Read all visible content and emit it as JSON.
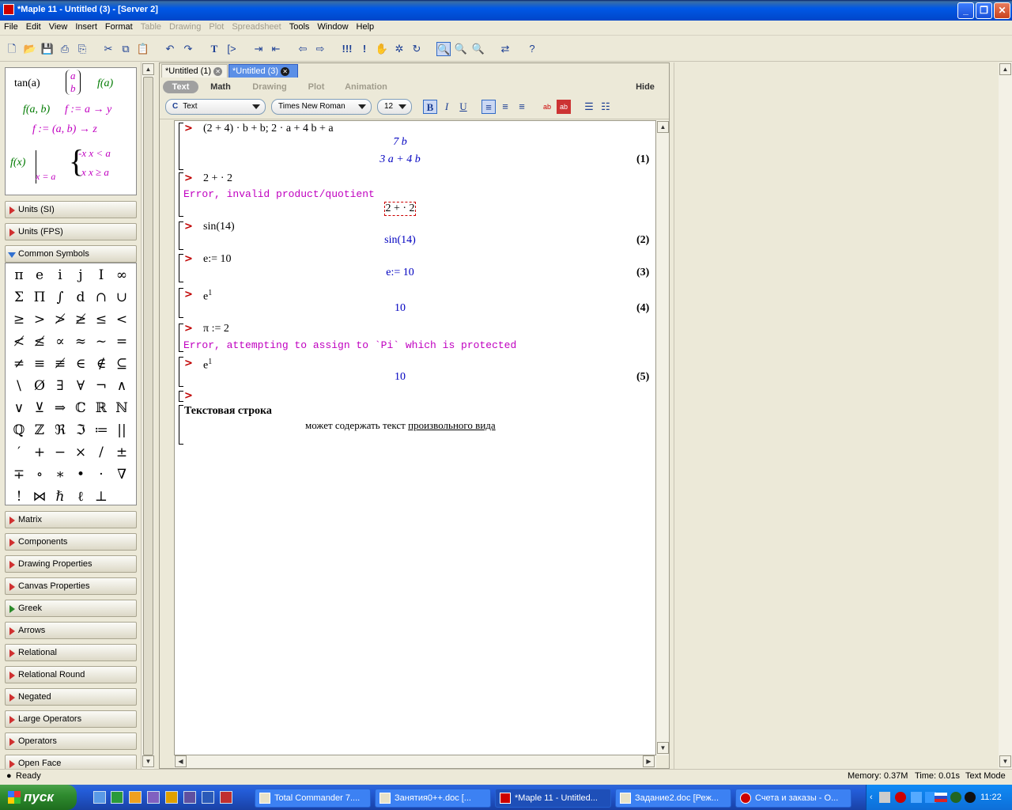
{
  "window": {
    "title": "*Maple 11 - Untitled (3) - [Server 2]"
  },
  "menu": [
    {
      "label": "File",
      "enabled": true
    },
    {
      "label": "Edit",
      "enabled": true
    },
    {
      "label": "View",
      "enabled": true
    },
    {
      "label": "Insert",
      "enabled": true
    },
    {
      "label": "Format",
      "enabled": true
    },
    {
      "label": "Table",
      "enabled": false
    },
    {
      "label": "Drawing",
      "enabled": false
    },
    {
      "label": "Plot",
      "enabled": false
    },
    {
      "label": "Spreadsheet",
      "enabled": false
    },
    {
      "label": "Tools",
      "enabled": true
    },
    {
      "label": "Window",
      "enabled": true
    },
    {
      "label": "Help",
      "enabled": true
    }
  ],
  "palette": {
    "expressions": {
      "tan": "tan(a)",
      "matrix_top": "a",
      "matrix_bottom": "b",
      "fa": "f(a)",
      "fab": "f(a, b)",
      "arrow1": "f := a → y",
      "arrow2": "f := (a, b) → z",
      "eval_fx": "f(x)",
      "eval_at": "x = a",
      "piece1": "-x   x < a",
      "piece2": "x   x ≥ a"
    },
    "sections_top": [
      "Units (SI)",
      "Units (FPS)"
    ],
    "common_symbols": {
      "label": "Common Symbols",
      "symbols": [
        "π",
        "e",
        "i",
        "j",
        "I",
        "∞",
        "Σ",
        "Π",
        "∫",
        "d",
        "∩",
        "∪",
        "≥",
        ">",
        "≯",
        "≱",
        "≤",
        "<",
        "≮",
        "≰",
        "∝",
        "≈",
        "~",
        "=",
        "≠",
        "≡",
        "≢",
        "∈",
        "∉",
        "⊆",
        "\\",
        "Ø",
        "∃",
        "∀",
        "¬",
        "∧",
        "∨",
        "⊻",
        "⇒",
        "ℂ",
        "ℝ",
        "ℕ",
        "ℚ",
        "ℤ",
        "ℜ",
        "ℑ",
        "≔",
        "||",
        "′",
        "+",
        "−",
        "×",
        "/",
        "±",
        "∓",
        "∘",
        "∗",
        "•",
        "·",
        "∇",
        "!",
        "⋈",
        "ℏ",
        "ℓ",
        "⊥"
      ]
    },
    "sections_bottom": [
      "Matrix",
      "Components",
      "Drawing Properties",
      "Canvas Properties",
      "Greek",
      "Arrows",
      "Relational",
      "Relational Round",
      "Negated",
      "Large Operators",
      "Operators",
      "Open Face"
    ]
  },
  "tabs": [
    {
      "label": "*Untitled (1)",
      "active": false
    },
    {
      "label": "*Untitled (3)",
      "active": true
    }
  ],
  "context_bar": {
    "modes": [
      "Text",
      "Math",
      "Drawing",
      "Plot",
      "Animation"
    ],
    "active_mode": "Text",
    "hide": "Hide",
    "style": "Text",
    "font": "Times New Roman",
    "size": "12"
  },
  "worksheet": {
    "cmd1": "(2 + 4) · b + b; 2 · a + 4 b + a",
    "out1a": "7 b",
    "out1b": "3 a + 4 b",
    "eq1": "(1)",
    "cmd2": "2 + · 2",
    "err2": "Error, invalid product/quotient",
    "err2_echo": "2 + · 2",
    "cmd3": "sin(14)",
    "out3": "sin(14)",
    "eq3": "(2)",
    "cmd4": "e:= 10",
    "out4": "e:= 10",
    "eq4": "(3)",
    "cmd5_base": "e",
    "cmd5_exp": "1",
    "out5": "10",
    "eq5": "(4)",
    "cmd6": "π := 2",
    "err6": "Error, attempting to assign to `Pi` which is protected",
    "cmd7_base": "e",
    "cmd7_exp": "1",
    "out7": "10",
    "eq7": "(5)",
    "text_heading": "Текстовая строка",
    "text_body": "может содержать текст",
    "text_link": "произвольного вида"
  },
  "status": {
    "ready": "Ready",
    "memory": "Memory: 0.37M",
    "time": "Time: 0.01s",
    "mode": "Text Mode"
  },
  "taskbar": {
    "start": "пуск",
    "tasks": [
      {
        "label": "Total Commander 7....",
        "active": false
      },
      {
        "label": "Занятия0++.doc [...",
        "active": false
      },
      {
        "label": "*Maple 11 - Untitled...",
        "active": true
      },
      {
        "label": "Задание2.doc [Реж...",
        "active": false
      },
      {
        "label": "Счета и заказы - O...",
        "active": false
      }
    ],
    "clock": "11:22"
  }
}
